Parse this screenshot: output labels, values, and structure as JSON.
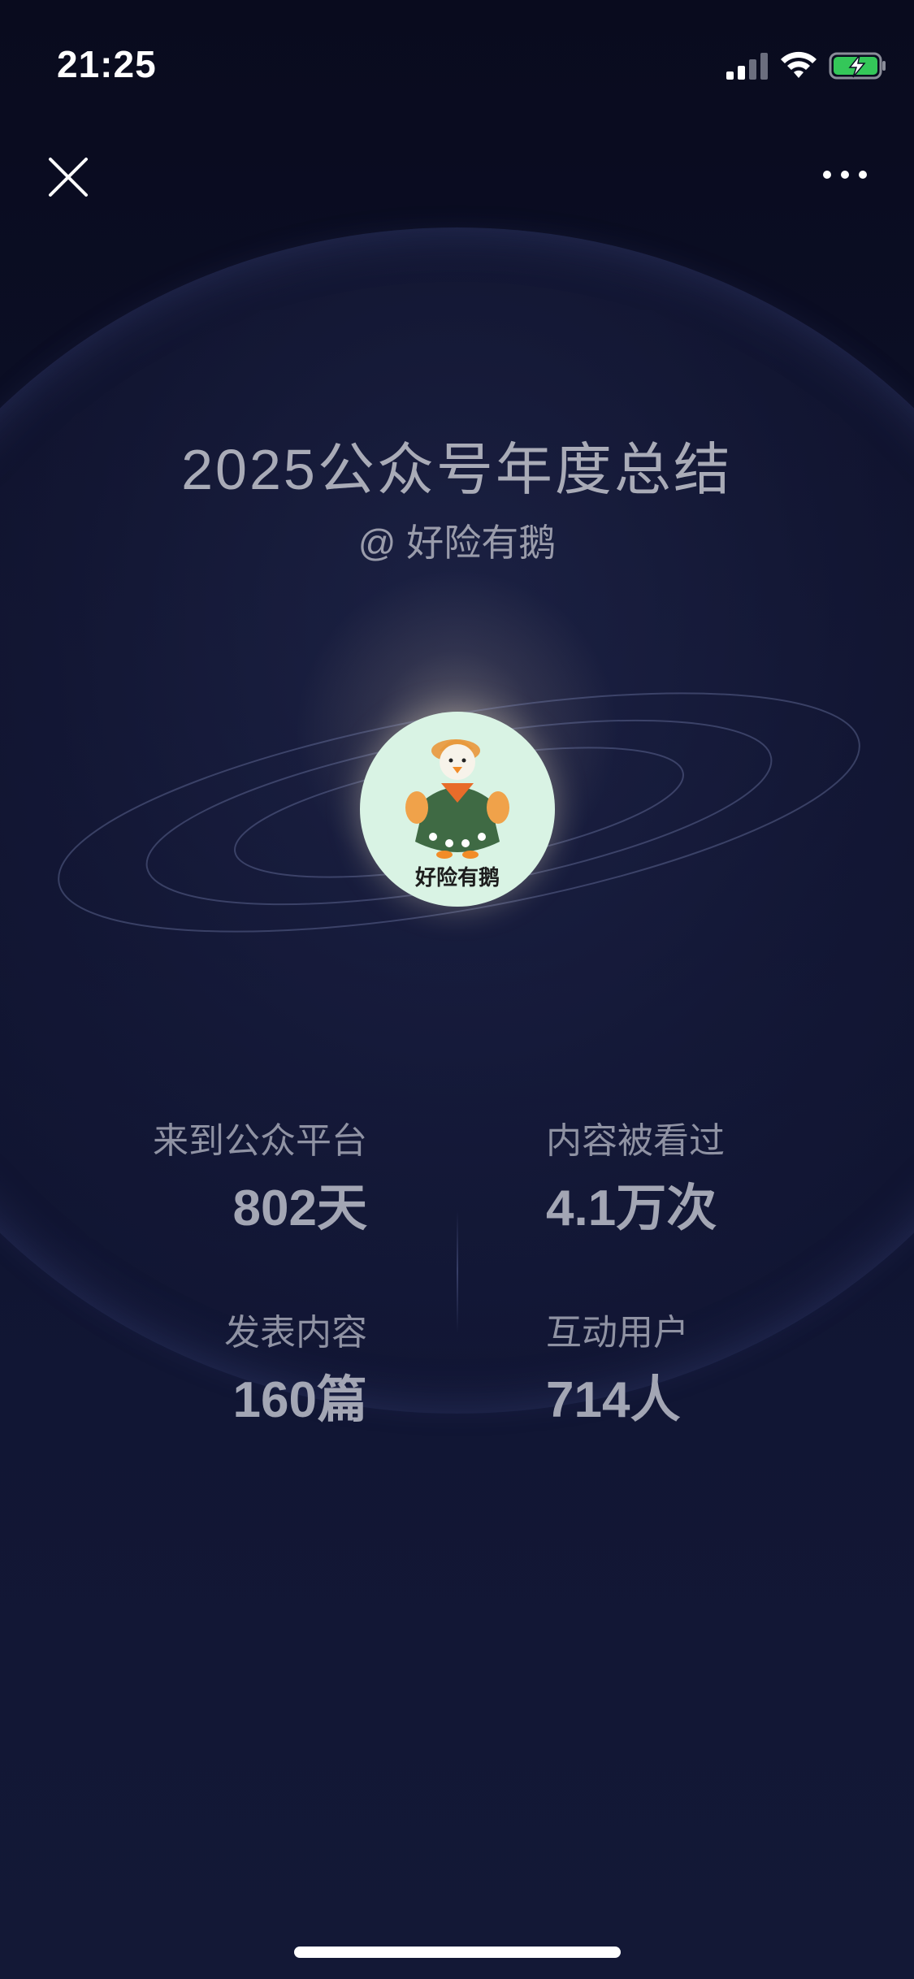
{
  "status_bar": {
    "time": "21:25"
  },
  "page": {
    "title": "2025公众号年度总结",
    "account_handle": "@ 好险有鹅",
    "avatar_text": "好险有鹅"
  },
  "stats": {
    "days_label": "来到公众平台",
    "days_value": "802天",
    "views_label": "内容被看过",
    "views_value": "4.1万次",
    "posts_label": "发表内容",
    "posts_value": "160篇",
    "users_label": "互动用户",
    "users_value": "714人"
  },
  "colors": {
    "background": "#0d1029",
    "battery_green": "#34c759",
    "avatar_bg": "#d9f3e4"
  }
}
